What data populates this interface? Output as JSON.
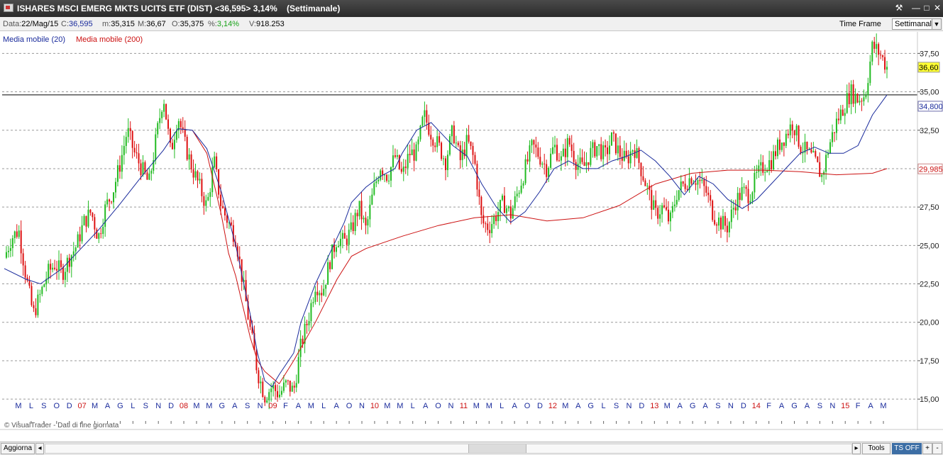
{
  "window": {
    "title": "ISHARES MSCI EMERG MKTS UCITS ETF (DIST) <36,595> 3,14%",
    "timeframe_label": "(Settimanale)",
    "buttons": [
      "tools-icon",
      "minimize-icon",
      "maximize-icon",
      "close-icon"
    ]
  },
  "info": {
    "date_label": "Data:",
    "date_value": "22/Mag/15",
    "close_label": "C:",
    "close_value": "36,595",
    "min_label": "m:",
    "min_value": "35,315",
    "max_label": "M:",
    "max_value": "36,67",
    "open_label": "O:",
    "open_value": "35,375",
    "pct_label": "%:",
    "pct_value": "3,14%",
    "vol_label": "V:",
    "vol_value": "918.253",
    "timeframe_button": "Time Frame",
    "timeframe_select": "Settimanale"
  },
  "legend": {
    "ma20": "Media mobile (20)",
    "ma200": "Media mobile (200)"
  },
  "footer": {
    "copyright": "© VisualTrader - Dati di fine giornata",
    "refresh_button": "Aggiorna",
    "tools_button": "Tools",
    "ts_button": "TS OFF",
    "plus_button": "+",
    "minus_button": "-"
  },
  "colors": {
    "up_candle": "#22bb22",
    "down_candle": "#dd1111",
    "ma20": "#1a2b9c",
    "ma200": "#cc1111",
    "last_price_box": "#ffff33"
  },
  "chart_data": {
    "type": "candlestick",
    "y_ticks": [
      "37,50",
      "35,00",
      "32,50",
      "30,00",
      "27,50",
      "25,00",
      "22,50",
      "20,00",
      "17,50",
      "15,00"
    ],
    "ylim": [
      13.3,
      38.9
    ],
    "grid": "horizontal dashed",
    "price_labels": {
      "last": "36,60",
      "horizontal_line": "34,800",
      "ma200_value": "29,985"
    },
    "horizontal_line_value": 34.8,
    "x_labels": [
      {
        "t": "M",
        "red": false
      },
      {
        "t": "L",
        "red": false
      },
      {
        "t": "S",
        "red": false
      },
      {
        "t": "O",
        "red": false
      },
      {
        "t": "D",
        "red": false
      },
      {
        "t": "07",
        "red": true
      },
      {
        "t": "M",
        "red": false
      },
      {
        "t": "A",
        "red": false
      },
      {
        "t": "G",
        "red": false
      },
      {
        "t": "L",
        "red": false
      },
      {
        "t": "S",
        "red": false
      },
      {
        "t": "N",
        "red": false
      },
      {
        "t": "D",
        "red": false
      },
      {
        "t": "08",
        "red": true
      },
      {
        "t": "M",
        "red": false
      },
      {
        "t": "M",
        "red": false
      },
      {
        "t": "G",
        "red": false
      },
      {
        "t": "A",
        "red": false
      },
      {
        "t": "S",
        "red": false
      },
      {
        "t": "N",
        "red": false
      },
      {
        "t": "09",
        "red": true
      },
      {
        "t": "F",
        "red": false
      },
      {
        "t": "A",
        "red": false
      },
      {
        "t": "M",
        "red": false
      },
      {
        "t": "L",
        "red": false
      },
      {
        "t": "A",
        "red": false
      },
      {
        "t": "O",
        "red": false
      },
      {
        "t": "N",
        "red": false
      },
      {
        "t": "10",
        "red": true
      },
      {
        "t": "M",
        "red": false
      },
      {
        "t": "M",
        "red": false
      },
      {
        "t": "L",
        "red": false
      },
      {
        "t": "A",
        "red": false
      },
      {
        "t": "O",
        "red": false
      },
      {
        "t": "N",
        "red": false
      },
      {
        "t": "11",
        "red": true
      },
      {
        "t": "M",
        "red": false
      },
      {
        "t": "M",
        "red": false
      },
      {
        "t": "L",
        "red": false
      },
      {
        "t": "A",
        "red": false
      },
      {
        "t": "O",
        "red": false
      },
      {
        "t": "D",
        "red": false
      },
      {
        "t": "12",
        "red": true
      },
      {
        "t": "M",
        "red": false
      },
      {
        "t": "A",
        "red": false
      },
      {
        "t": "G",
        "red": false
      },
      {
        "t": "L",
        "red": false
      },
      {
        "t": "S",
        "red": false
      },
      {
        "t": "N",
        "red": false
      },
      {
        "t": "D",
        "red": false
      },
      {
        "t": "13",
        "red": true
      },
      {
        "t": "M",
        "red": false
      },
      {
        "t": "A",
        "red": false
      },
      {
        "t": "G",
        "red": false
      },
      {
        "t": "A",
        "red": false
      },
      {
        "t": "S",
        "red": false
      },
      {
        "t": "N",
        "red": false
      },
      {
        "t": "D",
        "red": false
      },
      {
        "t": "14",
        "red": true
      },
      {
        "t": "F",
        "red": false
      },
      {
        "t": "A",
        "red": false
      },
      {
        "t": "G",
        "red": false
      },
      {
        "t": "A",
        "red": false
      },
      {
        "t": "S",
        "red": false
      },
      {
        "t": "N",
        "red": false
      },
      {
        "t": "15",
        "red": true
      },
      {
        "t": "F",
        "red": false
      },
      {
        "t": "A",
        "red": false
      },
      {
        "t": "M",
        "red": false
      }
    ],
    "series": [
      {
        "name": "Media mobile (20)",
        "type": "line",
        "values": [
          [
            0,
            23.5
          ],
          [
            3,
            22.8
          ],
          [
            5,
            22.5
          ],
          [
            8,
            23.5
          ],
          [
            10,
            24.5
          ],
          [
            13,
            26.0
          ],
          [
            16,
            27.7
          ],
          [
            19,
            29.5
          ],
          [
            22,
            31.2
          ],
          [
            24,
            32.6
          ],
          [
            26,
            32.5
          ],
          [
            28,
            31.3
          ],
          [
            30,
            28.5
          ],
          [
            32,
            25.0
          ],
          [
            34,
            20.5
          ],
          [
            35,
            18.0
          ],
          [
            36,
            16.2
          ],
          [
            37,
            15.8
          ],
          [
            38,
            16.6
          ],
          [
            40,
            18.0
          ],
          [
            41,
            20.0
          ],
          [
            43,
            22.5
          ],
          [
            45,
            24.5
          ],
          [
            47,
            26.5
          ],
          [
            48,
            27.8
          ],
          [
            50,
            28.8
          ],
          [
            52,
            29.5
          ],
          [
            54,
            30.0
          ],
          [
            55,
            31.0
          ],
          [
            57,
            32.5
          ],
          [
            59,
            33.0
          ],
          [
            60,
            32.5
          ],
          [
            62,
            31.5
          ],
          [
            64,
            30.8
          ],
          [
            66,
            29.0
          ],
          [
            68,
            27.5
          ],
          [
            70,
            26.5
          ],
          [
            72,
            27.2
          ],
          [
            74,
            28.5
          ],
          [
            76,
            30.0
          ],
          [
            78,
            30.5
          ],
          [
            80,
            30.0
          ],
          [
            82,
            30.0
          ],
          [
            84,
            30.5
          ],
          [
            86,
            30.8
          ],
          [
            88,
            31.2
          ],
          [
            90,
            30.5
          ],
          [
            92,
            29.5
          ],
          [
            94,
            28.3
          ],
          [
            96,
            29.5
          ],
          [
            98,
            29.0
          ],
          [
            100,
            28.0
          ],
          [
            102,
            27.4
          ],
          [
            104,
            28.0
          ],
          [
            106,
            29.0
          ],
          [
            108,
            30.0
          ],
          [
            110,
            31.0
          ],
          [
            112,
            31.4
          ],
          [
            114,
            31.0
          ],
          [
            116,
            31.0
          ],
          [
            118,
            31.5
          ],
          [
            120,
            33.5
          ],
          [
            122,
            34.8
          ]
        ]
      },
      {
        "name": "Media mobile (200)",
        "type": "line",
        "values": [
          [
            26,
            32.5
          ],
          [
            28,
            31.0
          ],
          [
            30,
            27.0
          ],
          [
            31,
            24.5
          ],
          [
            32,
            23.0
          ],
          [
            33,
            21.0
          ],
          [
            34,
            19.0
          ],
          [
            35,
            17.5
          ],
          [
            36,
            16.8
          ],
          [
            38,
            16.0
          ],
          [
            40,
            17.5
          ],
          [
            43,
            20.0
          ],
          [
            46,
            22.8
          ],
          [
            48,
            24.3
          ],
          [
            50,
            24.8
          ],
          [
            55,
            25.6
          ],
          [
            60,
            26.3
          ],
          [
            65,
            26.8
          ],
          [
            70,
            27.0
          ],
          [
            75,
            26.6
          ],
          [
            80,
            26.8
          ],
          [
            85,
            27.6
          ],
          [
            90,
            29.0
          ],
          [
            95,
            29.7
          ],
          [
            100,
            29.9
          ],
          [
            105,
            29.9
          ],
          [
            110,
            29.8
          ],
          [
            115,
            29.6
          ],
          [
            120,
            29.7
          ],
          [
            122,
            30.0
          ]
        ]
      },
      {
        "name": "price",
        "type": "candles",
        "anchors": [
          [
            0,
            24.2
          ],
          [
            1,
            25.5
          ],
          [
            2,
            26.0
          ],
          [
            3,
            23.0
          ],
          [
            4,
            20.5
          ],
          [
            5,
            21.8
          ],
          [
            6,
            23.2
          ],
          [
            7,
            23.8
          ],
          [
            8,
            23.2
          ],
          [
            9,
            24.2
          ],
          [
            10,
            25.0
          ],
          [
            11,
            26.5
          ],
          [
            12,
            27.2
          ],
          [
            13,
            25.5
          ],
          [
            14,
            27.5
          ],
          [
            15,
            28.5
          ],
          [
            16,
            30.3
          ],
          [
            17,
            32.5
          ],
          [
            18,
            31.0
          ],
          [
            19,
            30.0
          ],
          [
            20,
            29.0
          ],
          [
            21,
            32.0
          ],
          [
            22,
            34.8
          ],
          [
            23,
            31.0
          ],
          [
            24,
            33.5
          ],
          [
            25,
            31.5
          ],
          [
            26,
            30.0
          ],
          [
            27,
            28.8
          ],
          [
            28,
            27.5
          ],
          [
            29,
            30.5
          ],
          [
            30,
            27.5
          ],
          [
            31,
            26.5
          ],
          [
            32,
            25.5
          ],
          [
            33,
            22.5
          ],
          [
            34,
            19.5
          ],
          [
            35,
            16.8
          ],
          [
            36,
            15.2
          ],
          [
            37,
            15.8
          ],
          [
            38,
            15.3
          ],
          [
            39,
            16.0
          ],
          [
            40,
            15.5
          ],
          [
            41,
            18.5
          ],
          [
            42,
            20.2
          ],
          [
            43,
            22.5
          ],
          [
            44,
            22.0
          ],
          [
            45,
            24.0
          ],
          [
            46,
            25.5
          ],
          [
            47,
            25.2
          ],
          [
            48,
            26.0
          ],
          [
            49,
            27.5
          ],
          [
            50,
            26.0
          ],
          [
            51,
            28.5
          ],
          [
            52,
            30.2
          ],
          [
            53,
            29.5
          ],
          [
            54,
            30.8
          ],
          [
            55,
            29.5
          ],
          [
            56,
            31.0
          ],
          [
            57,
            31.0
          ],
          [
            58,
            33.5
          ],
          [
            59,
            32.3
          ],
          [
            60,
            31.5
          ],
          [
            61,
            30.5
          ],
          [
            62,
            32.5
          ],
          [
            63,
            30.5
          ],
          [
            64,
            31.8
          ],
          [
            65,
            30.5
          ],
          [
            66,
            26.5
          ],
          [
            67,
            26.2
          ],
          [
            68,
            27.0
          ],
          [
            69,
            27.8
          ],
          [
            70,
            27.0
          ],
          [
            71,
            28.5
          ],
          [
            72,
            30.0
          ],
          [
            73,
            31.5
          ],
          [
            74,
            30.8
          ],
          [
            75,
            30.0
          ],
          [
            76,
            31.5
          ],
          [
            77,
            30.5
          ],
          [
            78,
            31.8
          ],
          [
            79,
            30.5
          ],
          [
            80,
            30.0
          ],
          [
            81,
            31.0
          ],
          [
            82,
            31.5
          ],
          [
            83,
            30.8
          ],
          [
            84,
            32.0
          ],
          [
            85,
            31.0
          ],
          [
            86,
            30.5
          ],
          [
            87,
            31.5
          ],
          [
            88,
            30.0
          ],
          [
            89,
            28.5
          ],
          [
            90,
            27.0
          ],
          [
            91,
            27.5
          ],
          [
            92,
            26.5
          ],
          [
            93,
            28.5
          ],
          [
            94,
            29.0
          ],
          [
            95,
            29.5
          ],
          [
            96,
            29.2
          ],
          [
            97,
            28.5
          ],
          [
            98,
            27.0
          ],
          [
            99,
            26.5
          ],
          [
            100,
            26.2
          ],
          [
            101,
            27.8
          ],
          [
            102,
            28.5
          ],
          [
            103,
            28.3
          ],
          [
            104,
            29.5
          ],
          [
            105,
            30.2
          ],
          [
            106,
            30.5
          ],
          [
            107,
            31.5
          ],
          [
            108,
            32.2
          ],
          [
            109,
            33.0
          ],
          [
            110,
            31.5
          ],
          [
            111,
            31.0
          ],
          [
            112,
            30.5
          ],
          [
            113,
            29.5
          ],
          [
            114,
            31.5
          ],
          [
            115,
            33.0
          ],
          [
            116,
            34.0
          ],
          [
            117,
            35.0
          ],
          [
            118,
            34.5
          ],
          [
            119,
            34.8
          ],
          [
            120,
            38.0
          ],
          [
            121,
            37.5
          ],
          [
            122,
            36.6
          ]
        ]
      }
    ]
  }
}
